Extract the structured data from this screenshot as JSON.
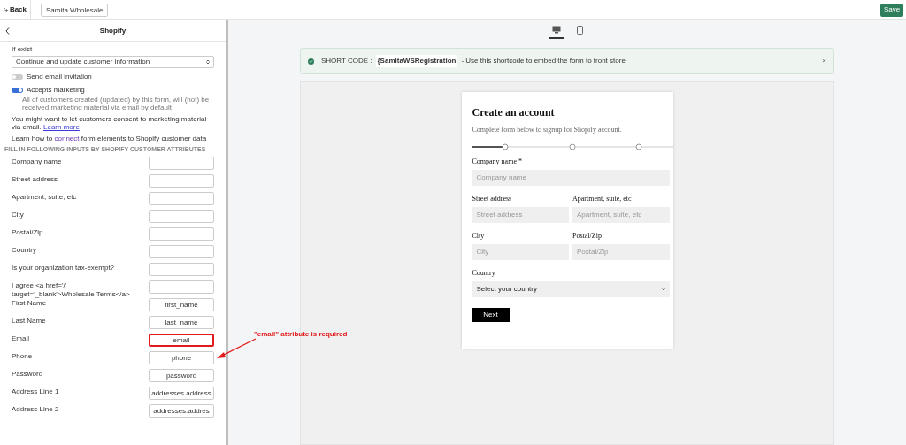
{
  "topbar": {
    "back": "Back",
    "form_name": "Samita Wholesale",
    "save": "Save"
  },
  "panel": {
    "title": "Shopify",
    "if_exist_label": "If exist",
    "if_exist_value": "Continue and update customer information",
    "toggles": [
      {
        "label": "Send email invitation",
        "on": false
      },
      {
        "label": "Accepts marketing",
        "on": true,
        "note": "All of customers created (updated) by this form, will (not) be received marketing material via email by default"
      }
    ],
    "consent_text": "You might want to let customers consent to marketing material via email.",
    "consent_link": "Learn more",
    "connect_before": "Learn how to",
    "connect_link": "connect",
    "connect_after": "form elements to Shopify customer data",
    "section_heading": "FILL IN FOLLOWING INPUTS BY SHOPIFY CUSTOMER ATTRIBUTES",
    "mappings": [
      {
        "label": "Company name"
      },
      {
        "label": "Street address"
      },
      {
        "label": "Apartment, suite, etc"
      },
      {
        "label": "City"
      },
      {
        "label": "Postal/Zip"
      },
      {
        "label": "Country"
      },
      {
        "label": "Is your organization tax-exempt?"
      },
      {
        "label": "I agree <a href='/' target='_blank'>Wholesale Terms</a>"
      },
      {
        "label": "First Name",
        "value": "first_name"
      },
      {
        "label": "Last Name",
        "value": "last_name"
      },
      {
        "label": "Email",
        "value": "email",
        "highlighted": true
      },
      {
        "label": "Phone",
        "value": "phone"
      },
      {
        "label": "Password",
        "value": "password"
      },
      {
        "label": "Address Line 1",
        "value": "addresses.address"
      },
      {
        "label": "Address Line 2",
        "value": "addresses.addres"
      }
    ]
  },
  "annotation": "\"email\" attribute is required",
  "devices": [
    {
      "kind": "desktop",
      "selected": true
    },
    {
      "kind": "mobile",
      "selected": false
    }
  ],
  "shortcode": {
    "label": "SHORT CODE :",
    "code": "{SamitaWSRegistration",
    "hint": "- Use this shortcode to embed the form to front store",
    "close": "×"
  },
  "form": {
    "title": "Create an account",
    "subtitle": "Complete form below to signup for Shopify account.",
    "fields": [
      {
        "label": "Company name *",
        "placeholder": "Company name",
        "kind": "text",
        "wide": true
      },
      {
        "label": "Street address",
        "placeholder": "Street address",
        "kind": "text",
        "wide": false
      },
      {
        "label": "Apartment, suite, etc",
        "placeholder": "Apartment, suite, etc",
        "kind": "text",
        "wide": false
      },
      {
        "label": "City",
        "placeholder": "City",
        "kind": "text",
        "wide": false
      },
      {
        "label": "Postal/Zip",
        "placeholder": "Postal/Zip",
        "kind": "text",
        "wide": false
      },
      {
        "label": "Country",
        "placeholder": "Select your country",
        "kind": "select",
        "wide": true
      }
    ],
    "button": "Next"
  }
}
